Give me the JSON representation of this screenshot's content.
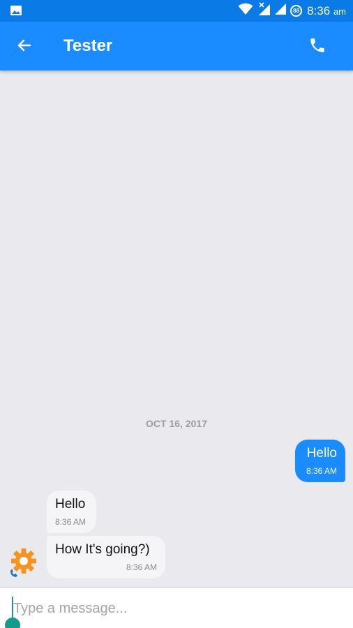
{
  "status_bar": {
    "time": "8:36",
    "ampm": "am",
    "battery_level": "88",
    "icons": [
      "gallery-icon",
      "wifi-icon",
      "cell-signal-no-data-icon",
      "cell-signal-icon",
      "battery-icon"
    ]
  },
  "header": {
    "title": "Tester",
    "icons": [
      "back-arrow-icon",
      "phone-icon"
    ]
  },
  "conversation": {
    "date_separator": "OCT 16, 2017",
    "messages": [
      {
        "direction": "outgoing",
        "text": "Hello",
        "time": "8:36 AM"
      },
      {
        "direction": "incoming",
        "text": "Hello",
        "time": "8:36 AM"
      },
      {
        "direction": "incoming",
        "text": "How It's going?)",
        "time": "8:36 AM"
      }
    ]
  },
  "composer": {
    "placeholder": "Type a message...",
    "value": ""
  },
  "colors": {
    "status_bar": "#0a7ae6",
    "app_bar": "#1a8cff",
    "outgoing_bubble": "#1a8cff",
    "incoming_bubble": "#f5f5f7",
    "background": "#e9e9ee",
    "cursor": "#159a8c",
    "avatar_gear": "#f7941d"
  }
}
